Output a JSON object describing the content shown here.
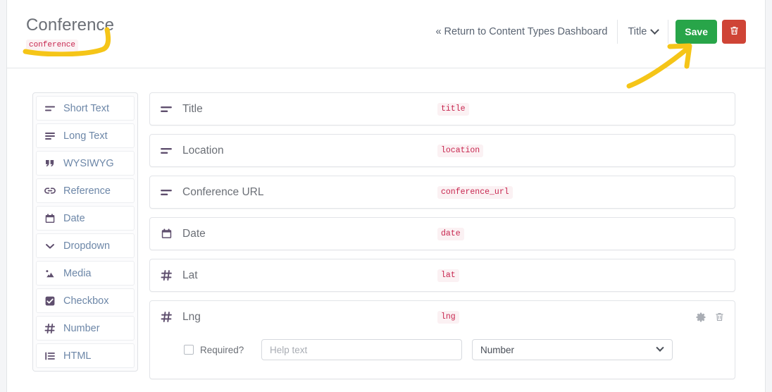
{
  "header": {
    "title": "Conference",
    "slug": "conference",
    "return_link": "« Return to Content Types Dashboard",
    "title_select": "Title",
    "save_label": "Save",
    "delete_icon": "trash-icon",
    "chevron_icon": "chevron-down-icon",
    "save_color": "#28a549",
    "delete_color": "#cf4436"
  },
  "sidebar": {
    "items": [
      {
        "label": "Short Text",
        "icon": "short-text-icon"
      },
      {
        "label": "Long Text",
        "icon": "long-text-icon"
      },
      {
        "label": "WYSIWYG",
        "icon": "quote-icon"
      },
      {
        "label": "Reference",
        "icon": "link-icon"
      },
      {
        "label": "Date",
        "icon": "calendar-icon"
      },
      {
        "label": "Dropdown",
        "icon": "chevron-down-icon"
      },
      {
        "label": "Media",
        "icon": "image-icon"
      },
      {
        "label": "Checkbox",
        "icon": "checkbox-icon"
      },
      {
        "label": "Number",
        "icon": "hash-icon"
      },
      {
        "label": "HTML",
        "icon": "list-icon"
      }
    ]
  },
  "fields": [
    {
      "label": "Title",
      "slug": "title",
      "icon": "short-text-icon",
      "expanded": false
    },
    {
      "label": "Location",
      "slug": "location",
      "icon": "short-text-icon",
      "expanded": false
    },
    {
      "label": "Conference URL",
      "slug": "conference_url",
      "icon": "short-text-icon",
      "expanded": false
    },
    {
      "label": "Date",
      "slug": "date",
      "icon": "calendar-icon",
      "expanded": false
    },
    {
      "label": "Lat",
      "slug": "lat",
      "icon": "hash-icon",
      "expanded": false
    },
    {
      "label": "Lng",
      "slug": "lng",
      "icon": "hash-icon",
      "expanded": true
    }
  ],
  "expanded_field": {
    "required_label": "Required?",
    "required_checked": false,
    "help_placeholder": "Help text",
    "help_value": "",
    "type_value": "Number",
    "settings_icon": "gear-icon",
    "delete_icon": "trash-icon"
  },
  "annotations": {
    "title_underline": "yellow-hook-underline",
    "save_arrow": "yellow-arrow-to-save",
    "color": "#f5c518"
  },
  "slug_badge_color": "#c7254e"
}
